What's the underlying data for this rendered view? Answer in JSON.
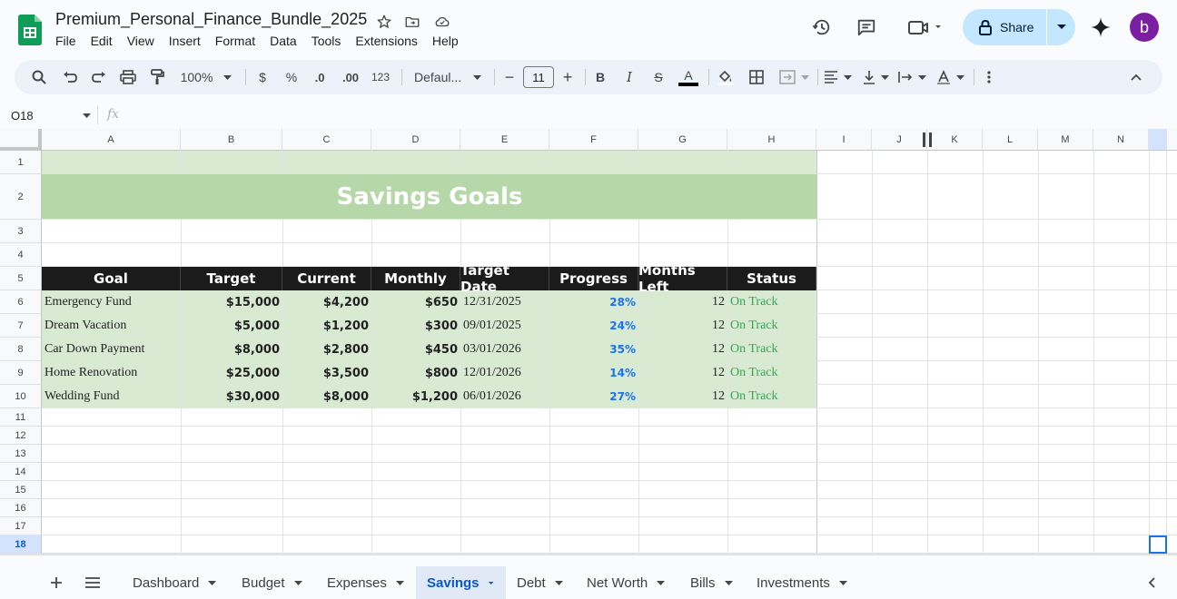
{
  "app": {
    "doc_title": "Premium_Personal_Finance_Bundle_2025",
    "menu": [
      "File",
      "Edit",
      "View",
      "Insert",
      "Format",
      "Data",
      "Tools",
      "Extensions",
      "Help"
    ],
    "share_label": "Share",
    "avatar_letter": "b"
  },
  "toolbar": {
    "zoom": "100%",
    "currency": "$",
    "percent": "%",
    "dec_decrease": ".0",
    "dec_increase": ".00",
    "number_format": "123",
    "font": "Defaul...",
    "font_size": "11",
    "minus": "−",
    "plus": "+",
    "bold": "B",
    "italic": "I",
    "strike": "S",
    "text_color": "A"
  },
  "formula_bar": {
    "cell_ref": "O18",
    "fx": "fx"
  },
  "grid": {
    "columns": [
      "A",
      "B",
      "C",
      "D",
      "E",
      "F",
      "G",
      "H",
      "I",
      "J",
      "K",
      "L",
      "M",
      "N"
    ],
    "rows": [
      "1",
      "2",
      "3",
      "4",
      "5",
      "6",
      "7",
      "8",
      "9",
      "10",
      "11",
      "12",
      "13",
      "14",
      "15",
      "16",
      "17",
      "18"
    ]
  },
  "sheet": {
    "banner_title": "Savings Goals",
    "headers": [
      "Goal",
      "Target",
      "Current",
      "Monthly",
      "Target Date",
      "Progress",
      "Months Left",
      "Status"
    ],
    "rows": [
      [
        "Emergency Fund",
        "$15,000",
        "$4,200",
        "$650",
        "12/31/2025",
        "28%",
        "12",
        "On Track"
      ],
      [
        "Dream Vacation",
        "$5,000",
        "$1,200",
        "$300",
        "09/01/2025",
        "24%",
        "12",
        "On Track"
      ],
      [
        "Car Down Payment",
        "$8,000",
        "$2,800",
        "$450",
        "03/01/2026",
        "35%",
        "12",
        "On Track"
      ],
      [
        "Home Renovation",
        "$25,000",
        "$3,500",
        "$800",
        "12/01/2026",
        "14%",
        "12",
        "On Track"
      ],
      [
        "Wedding Fund",
        "$30,000",
        "$8,000",
        "$1,200",
        "06/01/2026",
        "27%",
        "12",
        "On Track"
      ]
    ]
  },
  "tabs": [
    "Dashboard",
    "Budget",
    "Expenses",
    "Savings",
    "Debt",
    "Net Worth",
    "Bills",
    "Investments"
  ],
  "active_tab": "Savings",
  "colors": {
    "banner": "#b6d7a8",
    "light_green": "#d9ead3",
    "header_black": "#1b1b1b",
    "status_green": "#34a853",
    "progress_blue": "#1a73e8"
  }
}
